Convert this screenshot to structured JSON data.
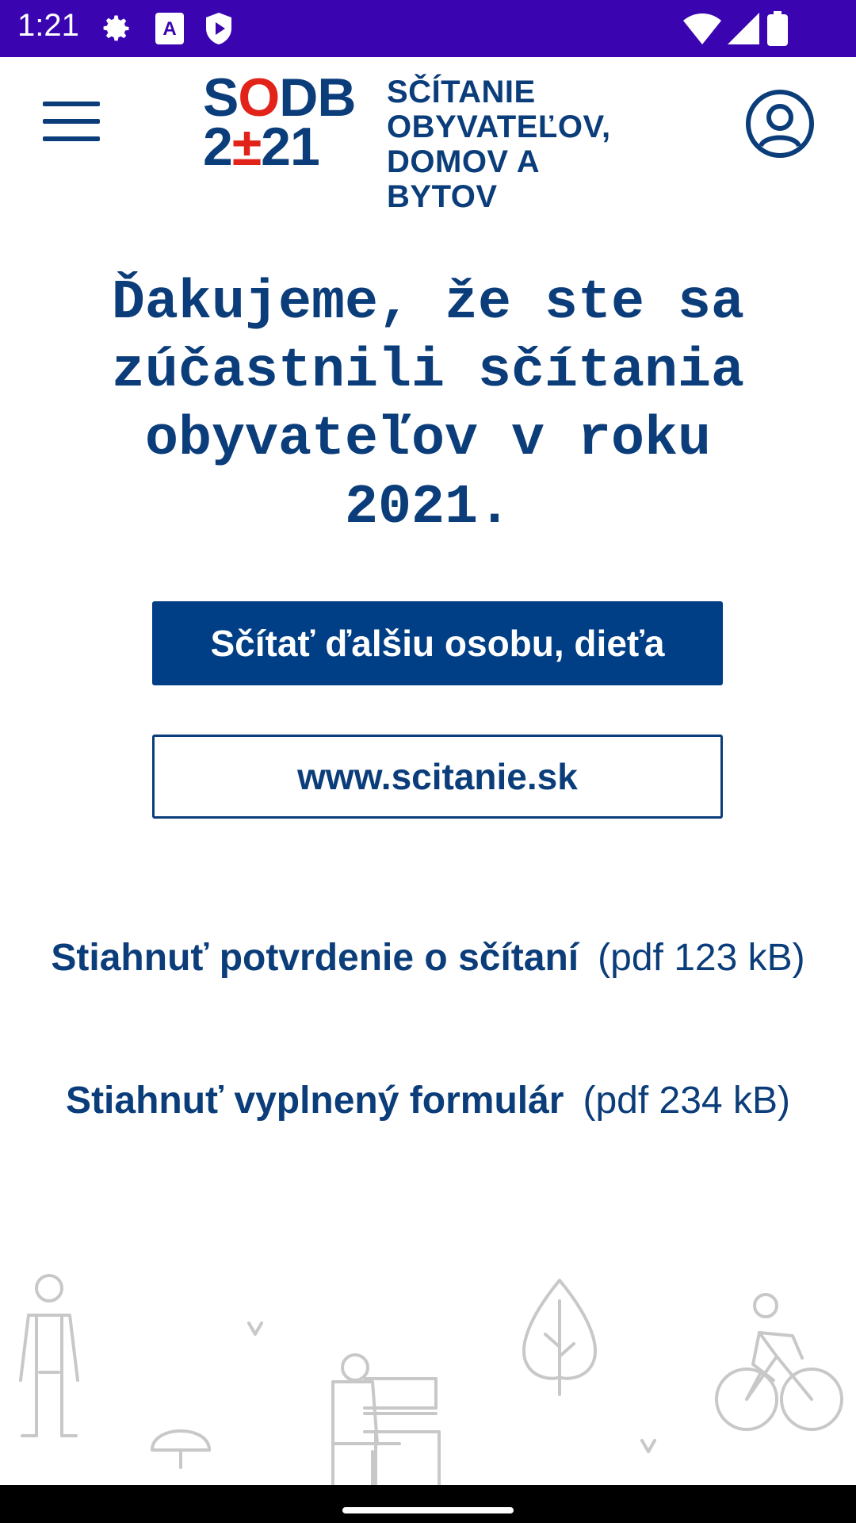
{
  "status_bar": {
    "time": "1:21",
    "background_color": "#3a05b0",
    "left_icons": [
      "settings-icon",
      "accessibility-a-icon",
      "shield-play-icon"
    ],
    "right_icons": [
      "wifi-icon",
      "signal-icon",
      "battery-icon"
    ]
  },
  "app_bar": {
    "menu_icon": "hamburger-menu-icon",
    "profile_icon": "user-profile-icon",
    "logo": {
      "mark_line1": "SODB",
      "mark_line2": "2±21",
      "text_lines": [
        "SČÍTANIE",
        "OBYVATEĽOV,",
        "DOMOV A BYTOV"
      ]
    }
  },
  "main": {
    "headline": "Ďakujeme, že ste sa\nzúčastnili sčítania\nobyvateľov v roku 2021.",
    "primary_button": "Sčítať ďalšiu osobu, dieťa",
    "secondary_button": "www.scitanie.sk",
    "downloads": [
      {
        "label": "Stiahnuť potvrdenie o sčítaní",
        "meta": "(pdf 123 kB)"
      },
      {
        "label": "Stiahnuť vyplnený formulár",
        "meta": "(pdf 234 kB)"
      }
    ]
  },
  "colors": {
    "brand_blue": "#0b3d7a",
    "button_blue": "#003e85",
    "brand_red": "#e2231a",
    "illustration_gray": "#c8c8c8"
  }
}
